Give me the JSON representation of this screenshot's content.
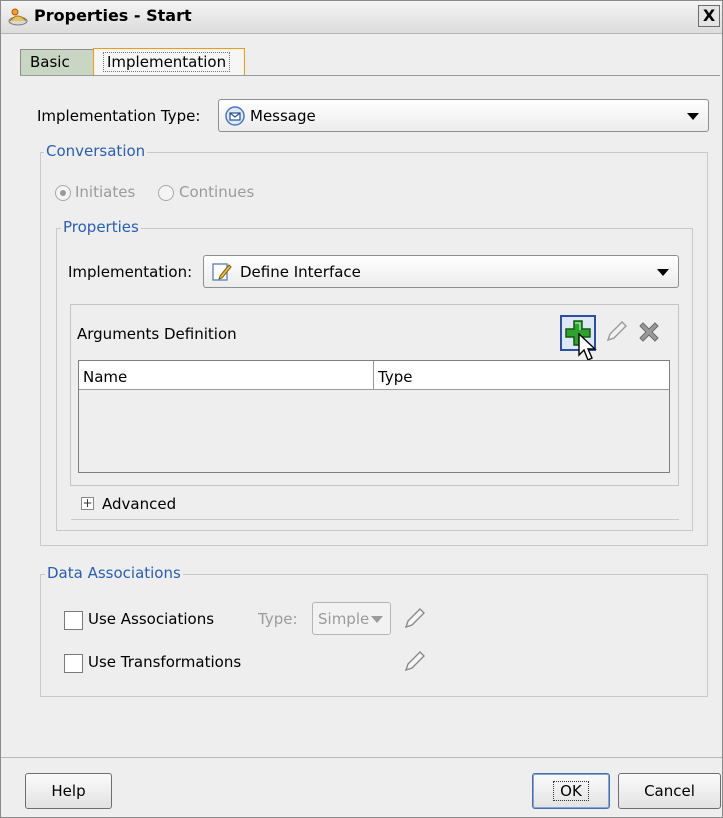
{
  "window": {
    "title": "Properties - Start",
    "close_glyph": "X"
  },
  "tabs": [
    {
      "label": "Basic"
    },
    {
      "label": "Implementation"
    }
  ],
  "implementation_type": {
    "label": "Implementation Type:",
    "value": "Message"
  },
  "conversation": {
    "legend": "Conversation",
    "radios": [
      {
        "label": "Initiates",
        "selected": true
      },
      {
        "label": "Continues",
        "selected": false
      }
    ]
  },
  "properties": {
    "legend": "Properties",
    "implementation_label": "Implementation:",
    "implementation_value": "Define Interface",
    "arguments_title": "Arguments Definition",
    "columns": [
      "Name",
      "Type"
    ],
    "rows": [],
    "advanced_label": "Advanced",
    "expand_glyph": "+"
  },
  "data_associations": {
    "legend": "Data Associations",
    "use_associations": "Use Associations",
    "type_label": "Type:",
    "type_value": "Simple",
    "use_transformations": "Use Transformations"
  },
  "buttons": {
    "help": "Help",
    "ok": "OK",
    "cancel": "Cancel"
  },
  "colors": {
    "legend": "#2a5db0",
    "add_icon": "#2fa12f",
    "delete_icon": "#8a8a8a"
  }
}
